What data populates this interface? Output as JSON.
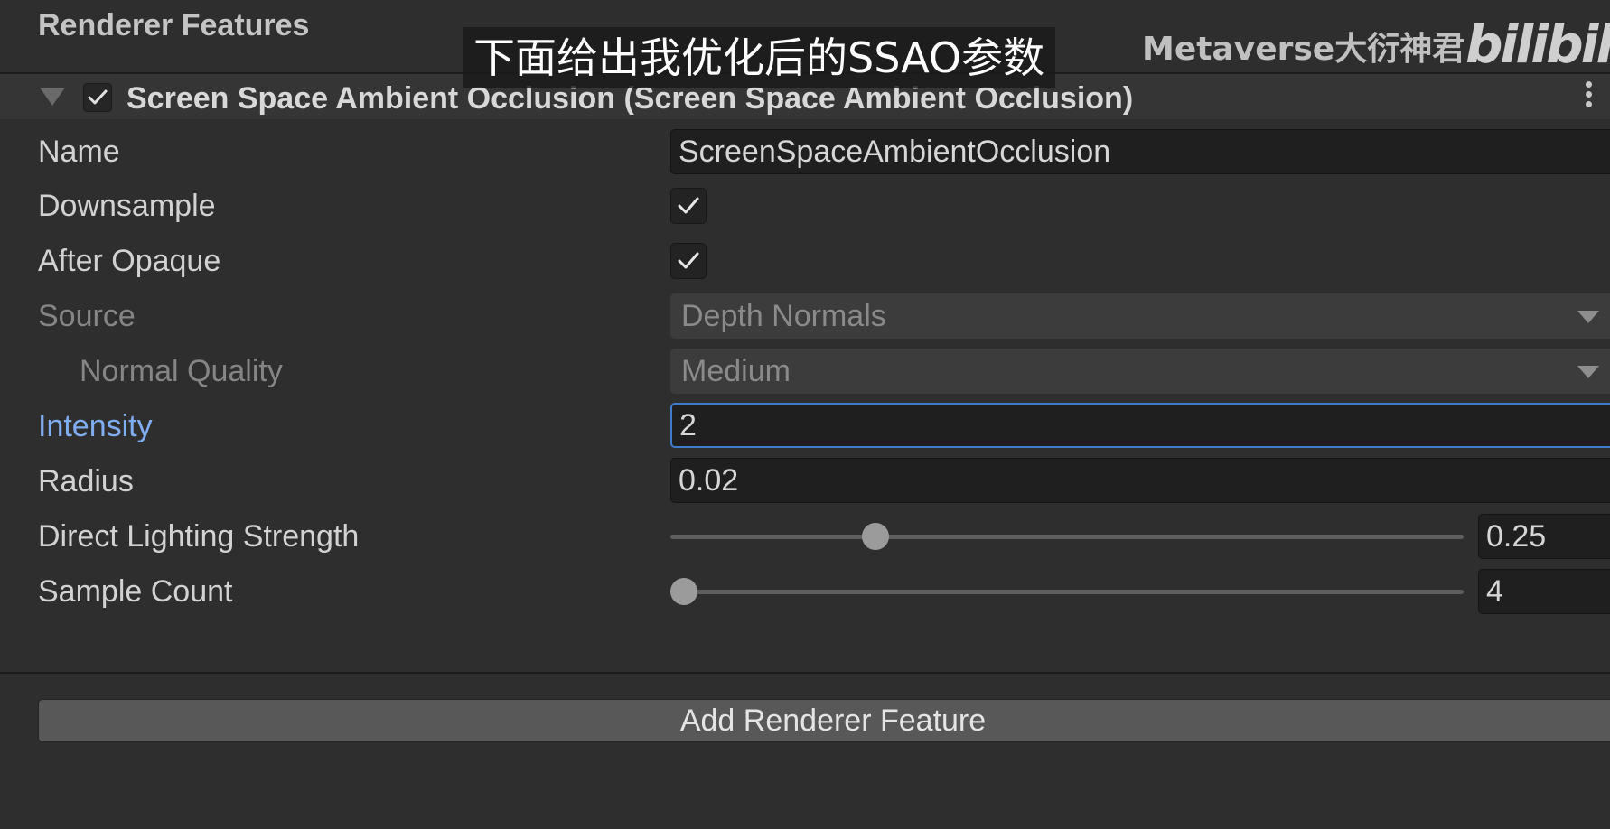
{
  "section": {
    "title": "Renderer Features"
  },
  "subtitle": "下面给出我优化后的SSAO参数",
  "watermark": {
    "text": "Metaverse大衍神君",
    "logo": "bilibili"
  },
  "component": {
    "title": "Screen Space Ambient Occlusion (Screen Space Ambient Occlusion)",
    "enabled": true,
    "expanded": true
  },
  "properties": {
    "name": {
      "label": "Name",
      "value": "ScreenSpaceAmbientOcclusion"
    },
    "downsample": {
      "label": "Downsample",
      "checked": true
    },
    "after_opaque": {
      "label": "After Opaque",
      "checked": true
    },
    "source": {
      "label": "Source",
      "value": "Depth Normals"
    },
    "normal_quality": {
      "label": "Normal Quality",
      "value": "Medium"
    },
    "intensity": {
      "label": "Intensity",
      "value": "2"
    },
    "radius": {
      "label": "Radius",
      "value": "0.02"
    },
    "direct_lighting_strength": {
      "label": "Direct Lighting Strength",
      "value": "0.25",
      "fraction": 0.25
    },
    "sample_count": {
      "label": "Sample Count",
      "value": "4",
      "fraction": 0.0
    }
  },
  "add_button": {
    "label": "Add Renderer Feature"
  },
  "icons": {
    "check": "checkmark-icon",
    "foldout": "foldout-triangle-icon",
    "menu": "kebab-menu-icon",
    "dropdown": "dropdown-caret-icon"
  },
  "colors": {
    "background": "#2e2e2e",
    "focus_label": "#7fadf0",
    "focus_border": "#3f7dc9",
    "field": "#1f1f1f"
  }
}
